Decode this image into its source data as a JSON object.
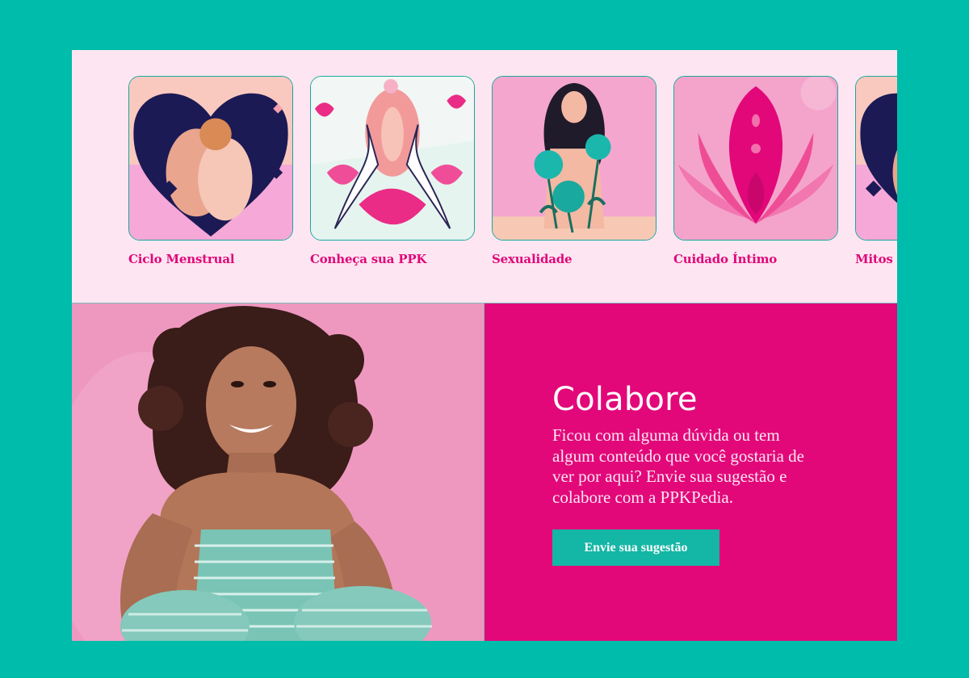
{
  "categories": [
    {
      "label": "Ciclo Menstrual",
      "illustration_icon": "heart-woman-icon"
    },
    {
      "label": "Conheça sua PPK",
      "illustration_icon": "vulva-hands-icon"
    },
    {
      "label": "Sexualidade",
      "illustration_icon": "woman-flowers-icon"
    },
    {
      "label": "Cuidado Íntimo",
      "illustration_icon": "lotus-icon"
    },
    {
      "label": "Mitos d",
      "illustration_icon": "heart-woman-icon"
    }
  ],
  "collab": {
    "title": "Colabore",
    "text": "Ficou com alguma dúvida ou tem algum conteúdo que você gostaria de ver por aqui? Envie sua sugestão e colabore com a PPKPedia.",
    "button_label": "Envie sua sugestão"
  },
  "colors": {
    "page_bg": "#00bcaa",
    "strip_bg": "#fde6f1",
    "accent_pink": "#e2087a",
    "button_teal": "#14b6a5",
    "card_border": "#1aa79a"
  }
}
